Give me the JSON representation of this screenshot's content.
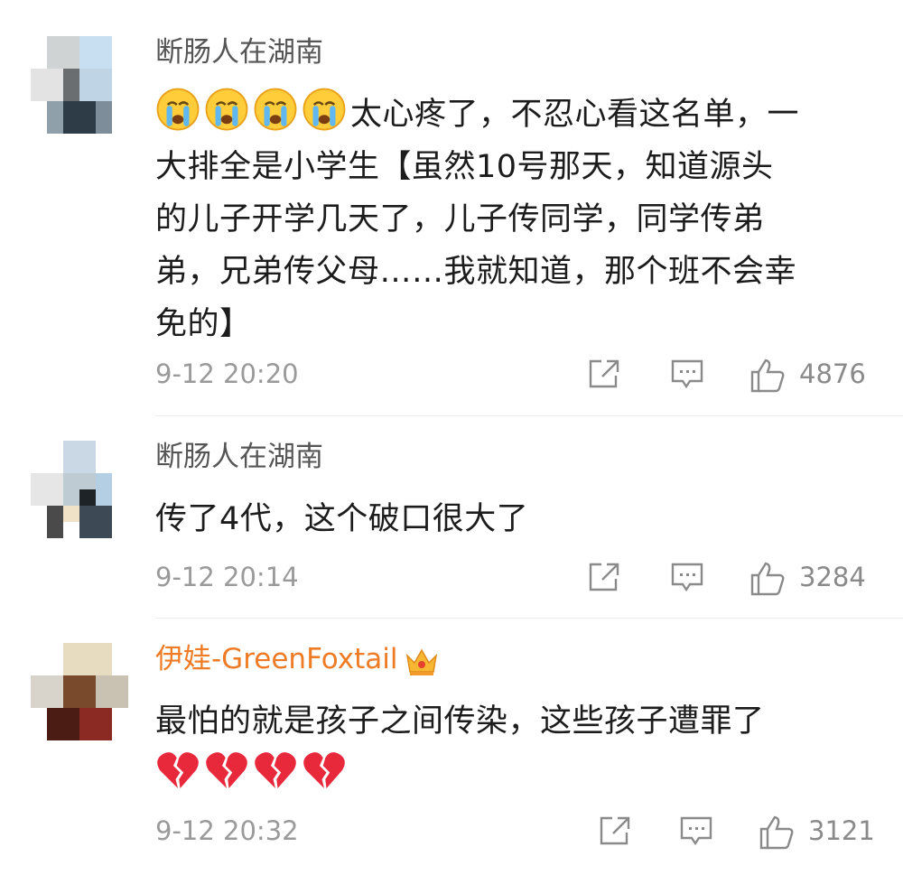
{
  "comments": [
    {
      "username": "断肠人在湖南",
      "text": "太心疼了，不忍心看这名单，一大排全是小学生【虽然10号那天，知道源头的儿子开学几天了，儿子传同学，同学传弟弟，兄弟传父母……我就知道，那个班不会幸免的】",
      "line1": "太心疼了，不忍心看这名单，一",
      "line2": "大排全是小学生【虽然10号那天，知道源头",
      "line3": "的儿子开学几天了，儿子传同学，同学传弟",
      "line4": "弟，兄弟传父母……我就知道，那个班不会幸",
      "line5": "免的】",
      "leading_emojis": [
        "crying-face-emoji",
        "crying-face-emoji",
        "crying-face-emoji",
        "crying-face-emoji"
      ],
      "time": "9-12 20:20",
      "likes": "4876"
    },
    {
      "username": "断肠人在湖南",
      "text": "传了4代，这个破口很大了",
      "time": "9-12 20:14",
      "likes": "3284"
    },
    {
      "username": "伊娃-GreenFoxtail",
      "username_color": "#ef7b24",
      "badge": "crown-icon",
      "text": "最怕的就是孩子之间传染，这些孩子遭罪了",
      "trailing_emojis": [
        "broken-heart-emoji",
        "broken-heart-emoji",
        "broken-heart-emoji",
        "broken-heart-emoji"
      ],
      "time": "9-12 20:32",
      "likes": "3121"
    }
  ],
  "icons": {
    "share": "share-icon",
    "reply": "comment-icon",
    "like": "thumbs-up-icon"
  },
  "colors": {
    "username": "#555555",
    "vip_username": "#ef7b24",
    "meta": "#9a9a9a"
  }
}
